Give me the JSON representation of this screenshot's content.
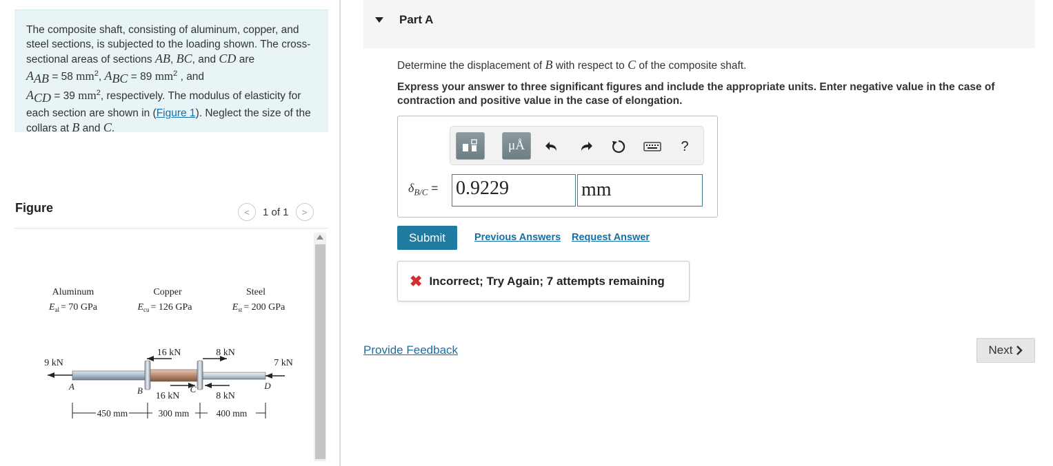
{
  "problem": {
    "text1": "The composite shaft, consisting of aluminum, copper, and steel sections, is subjected to the loading shown. The cross-sectional areas of sections",
    "sec_ab": "AB",
    "sec_bc": "BC",
    "and_word": ", and",
    "sec_cd": "CD",
    "are_word": "are",
    "area_ab_sym": "A",
    "area_ab_sub": "AB",
    "area_ab_val": "= 58",
    "area_bc_sym": "A",
    "area_bc_sub": "BC",
    "area_bc_val": "= 89",
    "area_cd_sym": "A",
    "area_cd_sub": "CD",
    "area_cd_val": "= 39",
    "unit_mm": "mm",
    "unit_pow": "2",
    "respectively": ", respectively. The modulus of elasticity for each section are shown in (",
    "figure_link": "Figure 1",
    "neglect": "). Neglect the size of the collars at",
    "collar_b": "B",
    "collar_c": "C"
  },
  "figure_panel": {
    "title": "Figure",
    "page": "1 of 1",
    "prev_glyph": "<",
    "next_glyph": ">",
    "diagram": {
      "al_label": "Aluminum",
      "al_modulus_sym": "E",
      "al_modulus_sub": "al",
      "al_modulus_val": "= 70 GPa",
      "cu_label": "Copper",
      "cu_modulus_sym": "E",
      "cu_modulus_sub": "cu",
      "cu_modulus_val": "= 126 GPa",
      "st_label": "Steel",
      "st_modulus_sym": "E",
      "st_modulus_sub": "st",
      "st_modulus_val": "= 200 GPa",
      "load_9": "9 kN",
      "load_16_top": "16 kN",
      "load_16_bottom": "16 kN",
      "load_8_top": "8 kN",
      "load_8_bottom": "8 kN",
      "load_7": "7 kN",
      "pt_a": "A",
      "pt_b": "B",
      "pt_c": "C",
      "pt_d": "D",
      "dim_ab": "450 mm",
      "dim_bc": "300 mm",
      "dim_cd": "400 mm"
    }
  },
  "part_a": {
    "label": "Part A",
    "question_pre": "Determine the displacement of",
    "question_b": "B",
    "question_mid": "with respect to",
    "question_c": "C",
    "question_post": "of the composite shaft.",
    "instructions": "Express your answer to three significant figures and include the appropriate units. Enter negative value in the case of contraction and positive value in the case of elongation.",
    "toolbar": {
      "units_btn": "μÅ",
      "help": "?"
    },
    "answer_label_sym": "δ",
    "answer_label_sub": "B/C",
    "answer_label_eq": "=",
    "answer_value": "0.9229",
    "answer_unit": "mm",
    "submit": "Submit",
    "previous_answers": "Previous Answers",
    "request_answer": "Request Answer",
    "feedback": "Incorrect; Try Again; 7 attempts remaining"
  },
  "footer": {
    "provide_feedback": "Provide Feedback",
    "next": "Next"
  },
  "colors": {
    "problem_bg": "#e8f4f6",
    "link": "#1470a8",
    "submit_bg": "#1f7ba0",
    "error_red": "#d32f2f"
  }
}
